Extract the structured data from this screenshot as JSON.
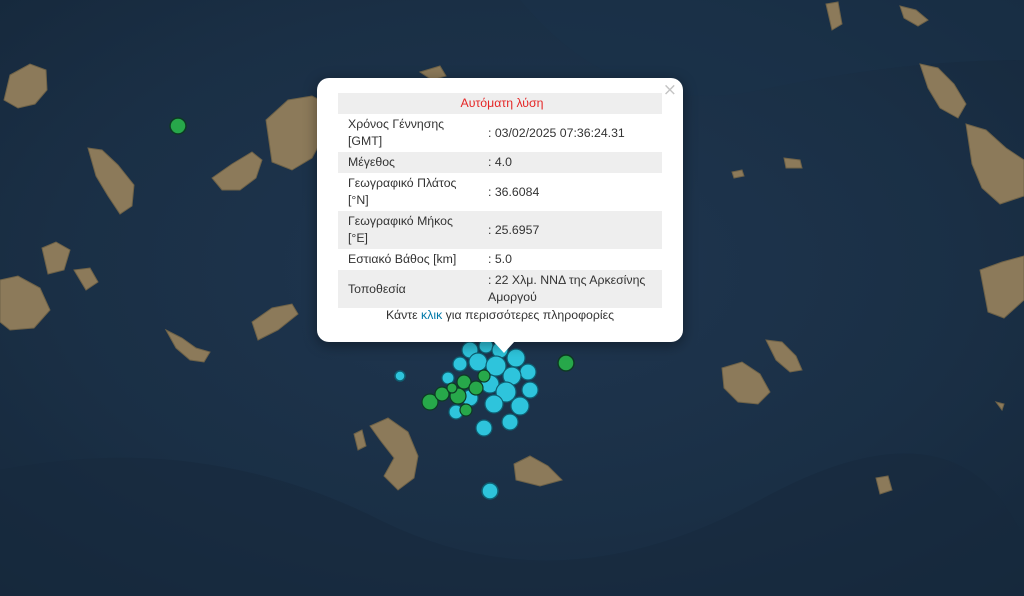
{
  "popup": {
    "title": "Αυτόματη λύση",
    "close_symbol": "×",
    "rows": [
      {
        "label": "Χρόνος Γέννησης [GMT]",
        "value": ": 03/02/2025 07:36:24.31"
      },
      {
        "label": "Μέγεθος",
        "value": ": 4.0"
      },
      {
        "label": "Γεωγραφικό Πλάτος [°N]",
        "value": ": 36.6084"
      },
      {
        "label": "Γεωγραφικό Μήκος [°E]",
        "value": ": 25.6957"
      },
      {
        "label": "Εστιακό Βάθος [km]",
        "value": ": 5.0"
      },
      {
        "label": "Τοποθεσία",
        "value": ": 22 Χλμ. ΝΝΔ της Αρκεσίνης Αμοργού"
      }
    ],
    "more_prefix": "Κάντε",
    "more_link": "κλικ",
    "more_suffix": "για περισσότερες πληροφορίες"
  },
  "colors": {
    "sea": "#1b3046",
    "marker_cyan": "#2ec4dc",
    "marker_green": "#27a84a",
    "title_red": "#e52525",
    "link_blue": "#0078a8"
  },
  "markers": [
    {
      "type": "green-isolated"
    },
    {
      "type": "green-isolated"
    },
    {
      "type": "cyan-isolated"
    },
    {
      "type": "cyan-isolated"
    },
    {
      "type": "cluster"
    }
  ]
}
